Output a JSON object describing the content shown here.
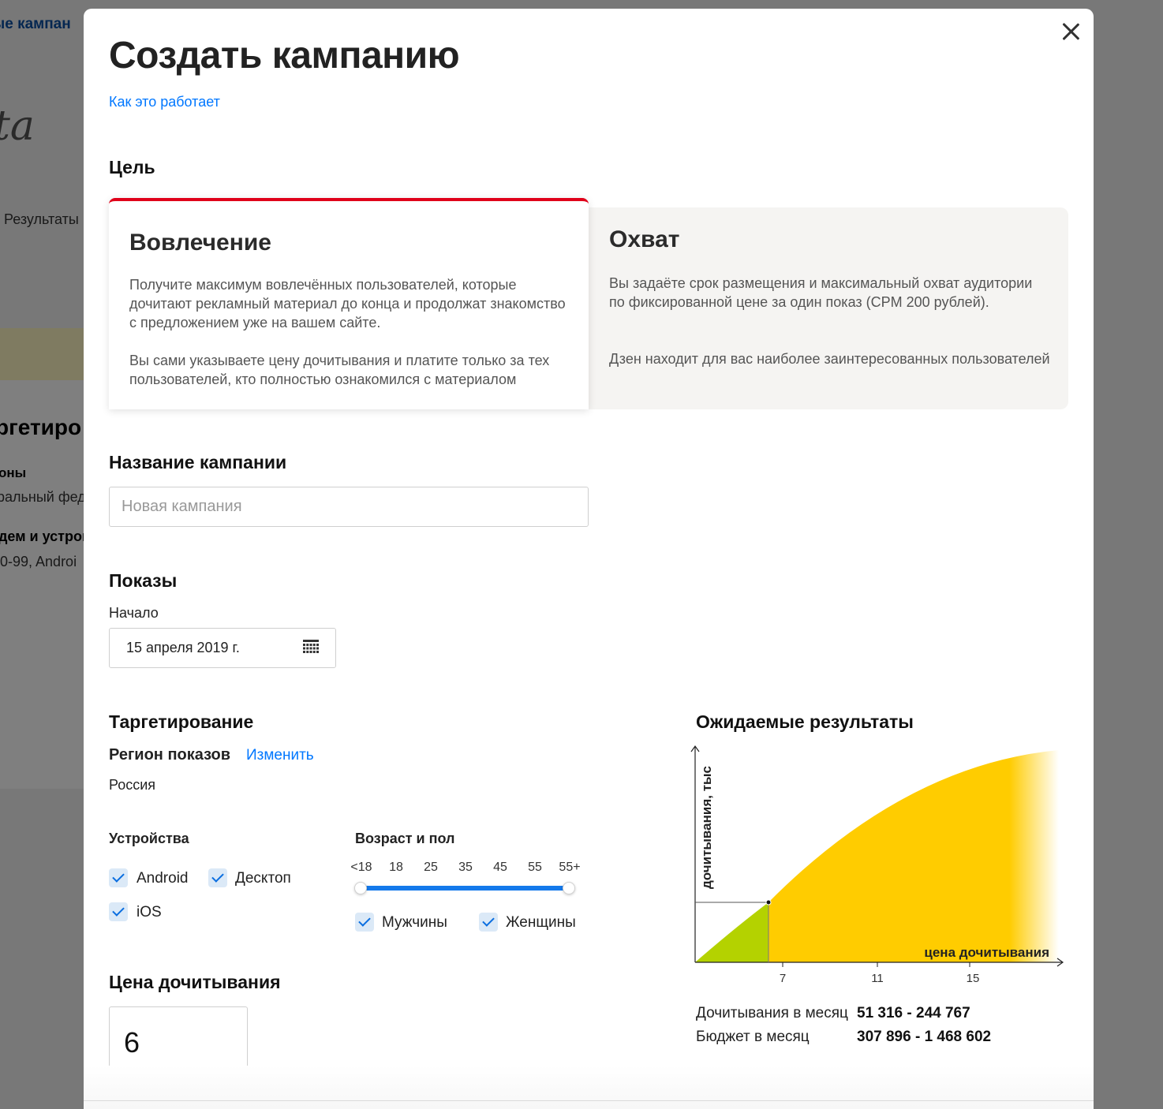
{
  "background": {
    "link": "ые кампан",
    "ta": "ta",
    "results": "Результаты",
    "targeting": "ргетиро",
    "regions": "оны",
    "federal": "ральный фед",
    "demo": "дем и устрой",
    "android": "0-99, Androi"
  },
  "modal": {
    "title": "Создать кампанию",
    "how_link": "Как это работает",
    "goal_heading": "Цель",
    "goals": [
      {
        "title": "Вовлечение",
        "p1": "Получите максимум вовлечённых пользователей, которые дочитают рекламный материал до конца и продолжат знакомство с предложением уже на вашем сайте.",
        "p2": "Вы сами указываете цену дочитывания и платите только за тех пользователей, кто полностью ознакомился с материалом",
        "accent": "#e0001a"
      },
      {
        "title": "Охват",
        "p1": "Вы задаёте срок размещения и максимальный охват аудитории по фиксированной цене за один показ (CPM 200 рублей).",
        "p2": "Дзен находит для вас наиболее заинтересованных пользователей"
      }
    ],
    "name_heading": "Название кампании",
    "name_placeholder": "Новая кампания",
    "shows_heading": "Показы",
    "start_label": "Начало",
    "start_date": "15 апреля 2019 г.",
    "targeting_heading": "Таргетирование",
    "region_label": "Регион показов",
    "change_link": "Изменить",
    "region_value": "Россия",
    "devices_heading": "Устройства",
    "devices": [
      {
        "label": "Android",
        "checked": true
      },
      {
        "label": "Десктоп",
        "checked": true
      },
      {
        "label": "iOS",
        "checked": true
      }
    ],
    "age_heading": "Возраст и пол",
    "age_ticks": [
      "<18",
      "18",
      "25",
      "35",
      "45",
      "55",
      "55+"
    ],
    "genders": [
      {
        "label": "Мужчины",
        "checked": true
      },
      {
        "label": "Женщины",
        "checked": true
      }
    ],
    "price_heading": "Цена дочитывания",
    "price_value": "6",
    "results_heading": "Ожидаемые результаты",
    "results": [
      {
        "label": "Дочитывания в месяц",
        "value": "51 316 - 244 767"
      },
      {
        "label": "Бюджет в месяц",
        "value": "307 896 - 1 468 602"
      }
    ],
    "colors": {
      "accent_red": "#e0001a",
      "link_blue": "#0077ff",
      "chart_yellow": "#ffcc00",
      "chart_green": "#b4d200"
    }
  },
  "chart_data": {
    "type": "area",
    "ylabel": "дочитывания, тыс",
    "xlabel": "цена дочитывания",
    "x_ticks": [
      "7",
      "11",
      "15"
    ],
    "marker_x": 6,
    "colors": {
      "below_marker": "#b4d200",
      "above_marker": "#ffcc00"
    }
  }
}
